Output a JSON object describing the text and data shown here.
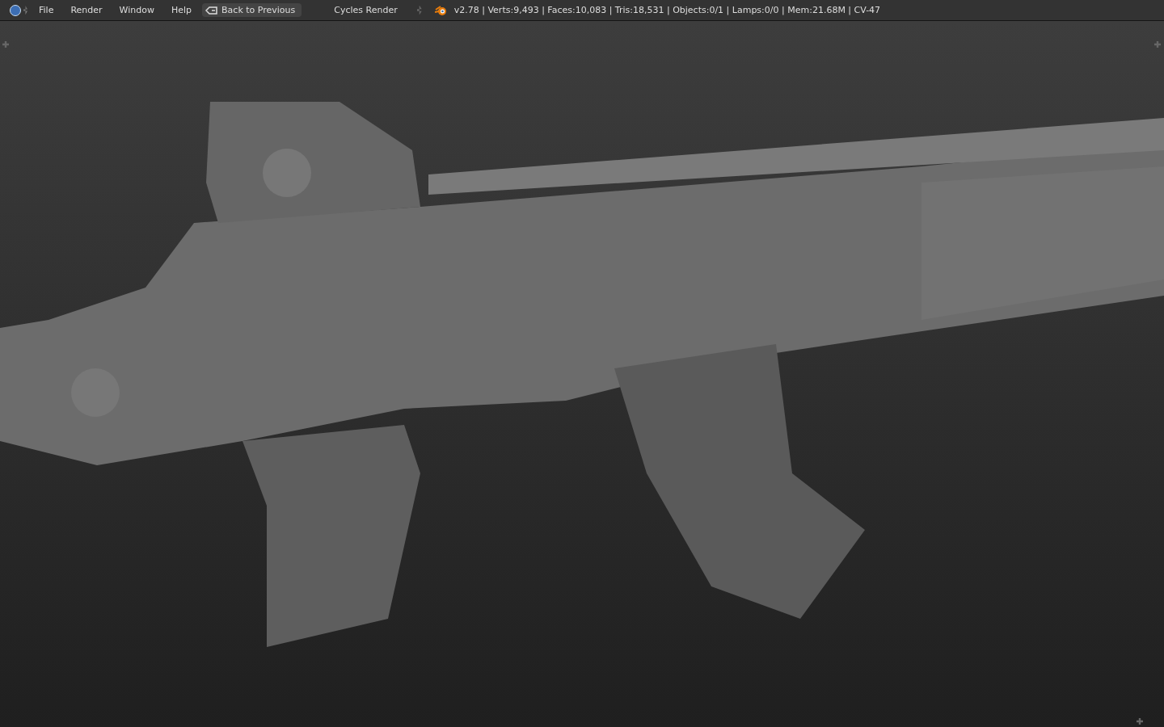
{
  "header": {
    "menus": [
      "File",
      "Render",
      "Window",
      "Help"
    ],
    "back_button": {
      "label": "Back to Previous"
    },
    "render_engine": {
      "value": "Cycles Render"
    },
    "stats": "v2.78 | Verts:9,493 | Faces:10,083 | Tris:18,531 | Objects:0/1 | Lamps:0/0 | Mem:21.68M | CV-47"
  }
}
